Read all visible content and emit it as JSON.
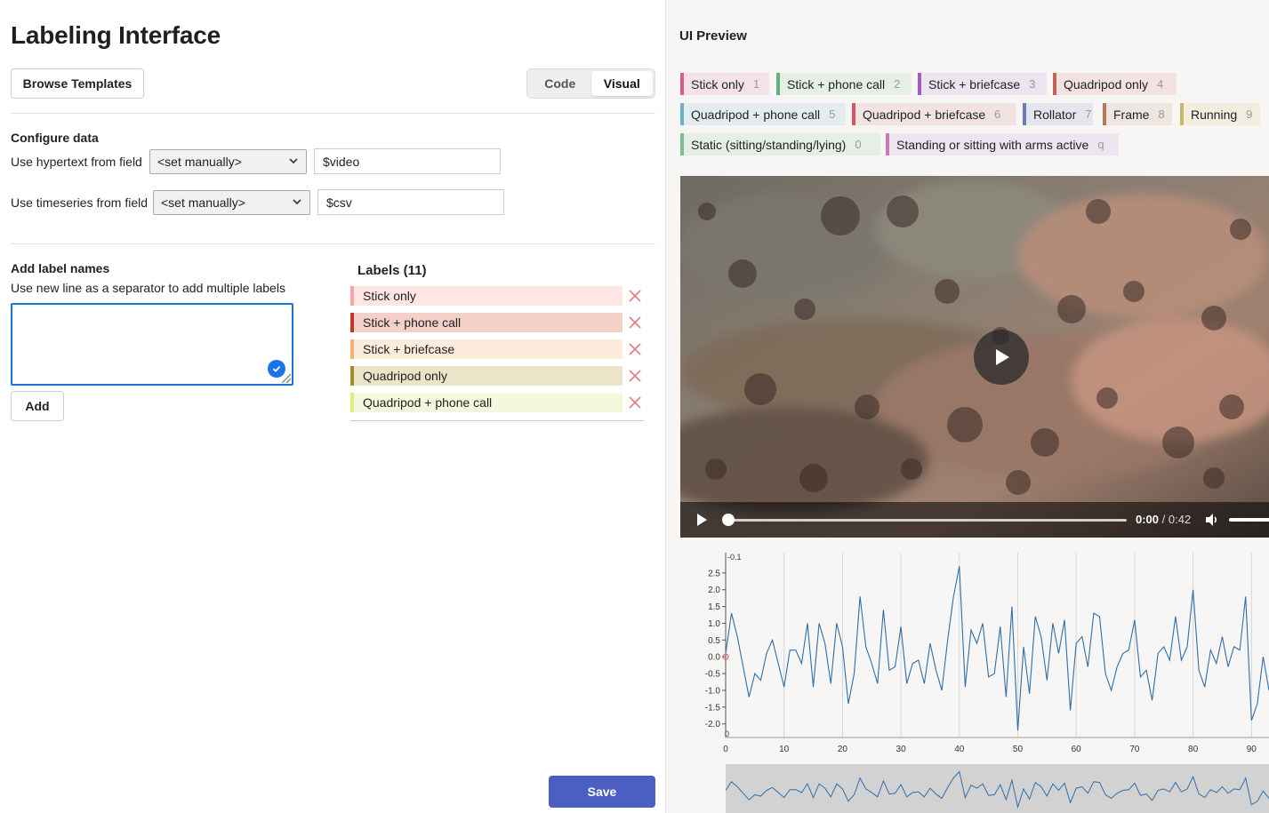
{
  "editor": {
    "title": "Labeling Interface",
    "browse_templates": "Browse Templates",
    "tabs": [
      {
        "label": "Code",
        "active": false
      },
      {
        "label": "Visual",
        "active": true
      }
    ],
    "configure_data": {
      "heading": "Configure data",
      "rows": [
        {
          "label": "Use hypertext from field",
          "select_value": "<set manually>",
          "input_value": "$video"
        },
        {
          "label": "Use timeseries from field",
          "select_value": "<set manually>",
          "input_value": "$csv"
        }
      ]
    },
    "add_labels": {
      "heading": "Add label names",
      "hint": "Use new line as a separator to add multiple labels",
      "textarea_value": "",
      "add_button": "Add"
    },
    "labels_heading": "Labels (11)",
    "labels": [
      {
        "name": "Stick only",
        "color": "#f5a6a6",
        "bg": "#fde6e4"
      },
      {
        "name": "Stick + phone call",
        "color": "#c0392b",
        "bg": "#f3d0c8"
      },
      {
        "name": "Stick + briefcase",
        "color": "#f3b27a",
        "bg": "#fdebdc"
      },
      {
        "name": "Quadripod only",
        "color": "#a88b2c",
        "bg": "#ece4c9"
      },
      {
        "name": "Quadripod + phone call",
        "color": "#d9ef7a",
        "bg": "#f4f8dd"
      }
    ],
    "save_button": "Save"
  },
  "preview": {
    "title": "UI Preview",
    "chips": [
      {
        "name": "Stick only",
        "key": "1",
        "color": "#d95b8c",
        "bg": "#f3e3e7"
      },
      {
        "name": "Stick + phone call",
        "key": "2",
        "color": "#5cb67a",
        "bg": "#e5efe5"
      },
      {
        "name": "Stick + briefcase",
        "key": "3",
        "color": "#a45cc2",
        "bg": "#ece4ef"
      },
      {
        "name": "Quadripod only",
        "key": "4",
        "color": "#c0655a",
        "bg": "#f2e3e1"
      },
      {
        "name": "Quadripod + phone call",
        "key": "5",
        "color": "#6fb0c9",
        "bg": "#e3edf0"
      },
      {
        "name": "Quadripod + briefcase",
        "key": "6",
        "color": "#d0575f",
        "bg": "#f2e2e2"
      },
      {
        "name": "Rollator",
        "key": "7",
        "color": "#6d7bb8",
        "bg": "#e4e6ef"
      },
      {
        "name": "Frame",
        "key": "8",
        "color": "#b57a5b",
        "bg": "#f0e6e0"
      },
      {
        "name": "Running",
        "key": "9",
        "color": "#c8b765",
        "bg": "#f1eee0"
      },
      {
        "name": "Static (sitting/standing/lying)",
        "key": "0",
        "color": "#7cbf8a",
        "bg": "#e5efe6"
      },
      {
        "name": "Standing or sitting with arms active",
        "key": "q",
        "color": "#c77ab8",
        "bg": "#efe5ee"
      }
    ],
    "video": {
      "current_time": "0:00",
      "duration": "/ 0:42"
    }
  },
  "chart_data": {
    "type": "line",
    "title": "",
    "xlabel": "",
    "ylabel": "",
    "x_ticks": [
      0,
      10,
      20,
      30,
      40,
      50,
      60,
      70,
      80,
      90
    ],
    "y_ticks": [
      "2.5",
      "2.0",
      "1.5",
      "1.0",
      "0.5",
      "0.0",
      "-0.5",
      "-1.0",
      "-1.5",
      "-2.0"
    ],
    "y_top_label": "-0.1",
    "x_corner_label": "0",
    "ylim": [
      -2.3,
      3.0
    ],
    "xlim": [
      0,
      93
    ],
    "color": "#2f6fa8",
    "series": [
      {
        "values": [
          0.1,
          1.3,
          0.6,
          -0.3,
          -1.2,
          -0.5,
          -0.7,
          0.1,
          0.5,
          -0.2,
          -0.9,
          0.2,
          0.2,
          -0.2,
          1.0,
          -0.9,
          1.0,
          0.4,
          -0.8,
          1.0,
          0.3,
          -1.4,
          -0.5,
          1.8,
          0.3,
          -0.2,
          -0.8,
          1.4,
          -0.4,
          -0.3,
          0.9,
          -0.8,
          -0.2,
          -0.1,
          -0.8,
          0.4,
          -0.4,
          -1.0,
          0.5,
          1.8,
          2.7,
          -0.9,
          0.8,
          0.4,
          1.0,
          -0.6,
          -0.5,
          0.9,
          -1.2,
          1.5,
          -2.2,
          0.3,
          -1.1,
          1.2,
          0.6,
          -0.7,
          1.0,
          0.1,
          1.1,
          -1.6,
          0.4,
          0.6,
          -0.3,
          1.3,
          1.2,
          -0.5,
          -1.0,
          -0.3,
          0.1,
          0.2,
          1.1,
          -0.6,
          -0.4,
          -1.3,
          0.1,
          0.3,
          -0.1,
          1.2,
          -0.1,
          0.3,
          2.0,
          -0.4,
          -0.9,
          0.2,
          -0.2,
          0.6,
          -0.3,
          0.3,
          0.2,
          1.8,
          -1.9,
          -1.4,
          0.0,
          -1.0
        ]
      }
    ]
  }
}
